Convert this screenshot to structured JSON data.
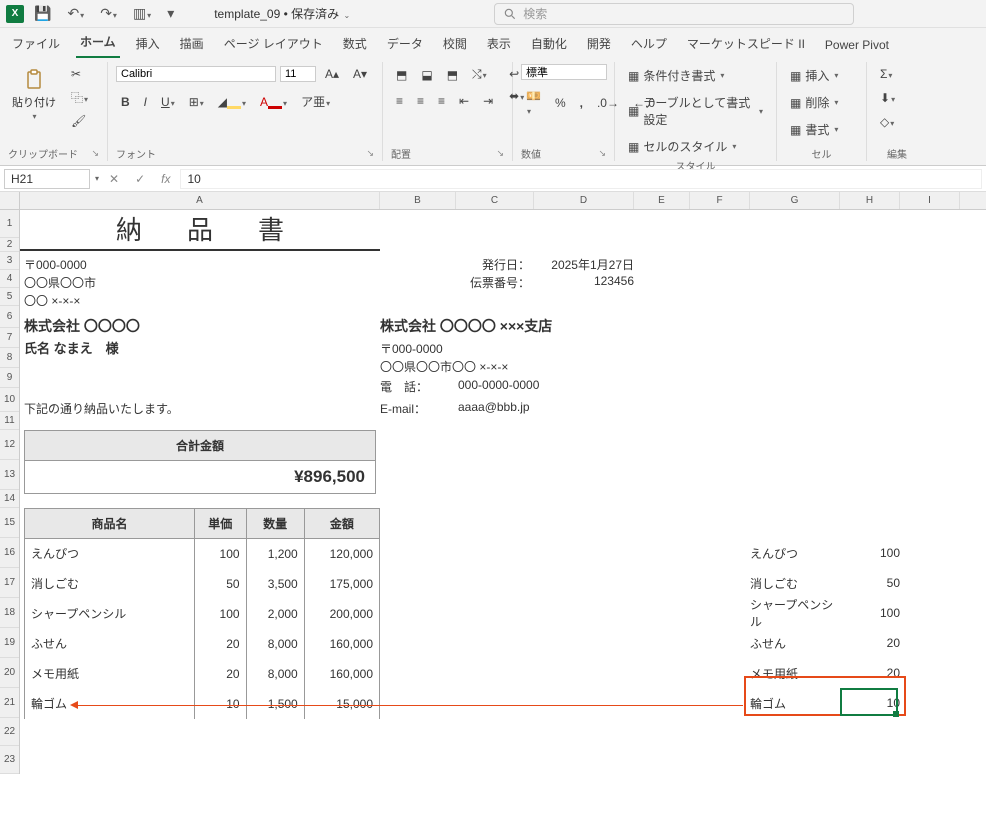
{
  "app": {
    "doc_title": "template_09 • 保存済み",
    "search_placeholder": "検索"
  },
  "tabs": [
    "ファイル",
    "ホーム",
    "挿入",
    "描画",
    "ページ レイアウト",
    "数式",
    "データ",
    "校閲",
    "表示",
    "自動化",
    "開発",
    "ヘルプ",
    "マーケットスピード II",
    "Power Pivot"
  ],
  "ribbon": {
    "clipboard": {
      "label": "クリップボード",
      "paste": "貼り付け"
    },
    "font": {
      "label": "フォント",
      "name": "Calibri",
      "size": "11"
    },
    "alignment": {
      "label": "配置"
    },
    "number": {
      "label": "数値",
      "format": "標準"
    },
    "styles": {
      "label": "スタイル",
      "cond": "条件付き書式",
      "table_fmt": "テーブルとして書式設定",
      "cell_styles": "セルのスタイル"
    },
    "cells": {
      "label": "セル",
      "insert": "挿入",
      "delete": "削除",
      "format": "書式"
    },
    "editing": {
      "label": "編集"
    }
  },
  "formula_bar": {
    "cell_ref": "H21",
    "value": "10"
  },
  "columns": [
    "A",
    "B",
    "C",
    "D",
    "E",
    "F",
    "G",
    "H",
    "I"
  ],
  "doc": {
    "title": "納品書",
    "postal": "〒000-0000",
    "address": "〇〇県〇〇市",
    "street": "〇〇 ×-×-×",
    "company": "株式会社 〇〇〇〇",
    "name_line": "氏名 なまえ　様",
    "intro": "下記の通り納品いたします。",
    "issue_label": "発行日：",
    "issue_date": "2025年1月27日",
    "slip_label": "伝票番号：",
    "slip_no": "123456",
    "sender_company": "株式会社 〇〇〇〇 ×××支店",
    "sender_postal": "〒000-0000",
    "sender_address": "〇〇県〇〇市〇〇 ×-×-×",
    "phone_label": "電　話：",
    "phone": "000-0000-0000",
    "email_label": "E-mail：",
    "email": "aaaa@bbb.jp",
    "total_label": "合計金額",
    "total_value": "¥896,500",
    "item_headers": {
      "name": "商品名",
      "price": "単価",
      "qty": "数量",
      "amount": "金額"
    },
    "items": [
      {
        "name": "えんぴつ",
        "price": "100",
        "qty": "1,200",
        "amount": "120,000"
      },
      {
        "name": "消しごむ",
        "price": "50",
        "qty": "3,500",
        "amount": "175,000"
      },
      {
        "name": "シャープペンシル",
        "price": "100",
        "qty": "2,000",
        "amount": "200,000"
      },
      {
        "name": "ふせん",
        "price": "20",
        "qty": "8,000",
        "amount": "160,000"
      },
      {
        "name": "メモ用紙",
        "price": "20",
        "qty": "8,000",
        "amount": "160,000"
      },
      {
        "name": "輪ゴム",
        "price": "10",
        "qty": "1,500",
        "amount": "15,000"
      }
    ],
    "side_items": [
      {
        "name": "えんぴつ",
        "val": "100"
      },
      {
        "name": "消しごむ",
        "val": "50"
      },
      {
        "name": "シャープペンシル",
        "val": "100"
      },
      {
        "name": "ふせん",
        "val": "20"
      },
      {
        "name": "メモ用紙",
        "val": "20"
      },
      {
        "name": "輪ゴム",
        "val": "10"
      }
    ]
  }
}
